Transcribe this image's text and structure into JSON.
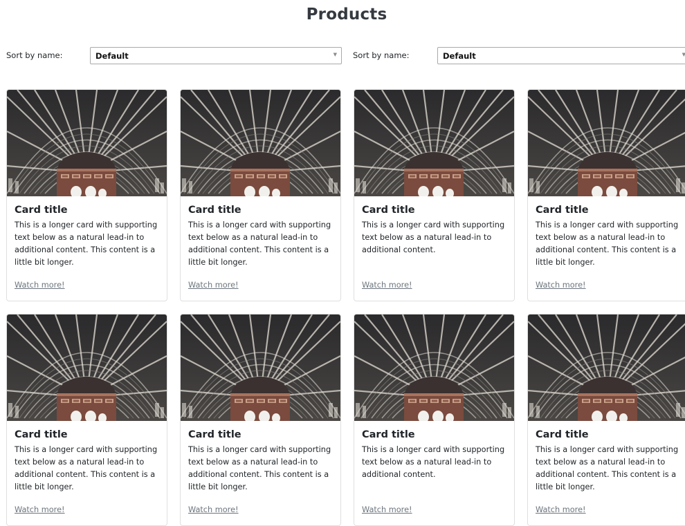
{
  "page": {
    "title": "Products"
  },
  "sort_controls": [
    {
      "label": "Sort by name:",
      "selected": "Default"
    },
    {
      "label": "Sort by name:",
      "selected": "Default"
    }
  ],
  "cards": [
    {
      "title": "Card title",
      "text": "This is a longer card with supporting text below as a natural lead-in to additional content. This content is a little bit longer.",
      "link": "Watch more!"
    },
    {
      "title": "Card title",
      "text": "This is a longer card with supporting text below as a natural lead-in to additional content. This content is a little bit longer.",
      "link": "Watch more!"
    },
    {
      "title": "Card title",
      "text": "This is a longer card with supporting text below as a natural lead-in to additional content.",
      "link": "Watch more!"
    },
    {
      "title": "Card title",
      "text": "This is a longer card with supporting text below as a natural lead-in to additional content. This content is a little bit longer.",
      "link": "Watch more!"
    },
    {
      "title": "Card title",
      "text": "This is a longer card with supporting text below as a natural lead-in to additional content. This content is a little bit longer.",
      "link": "Watch more!"
    },
    {
      "title": "Card title",
      "text": "This is a longer card with supporting text below as a natural lead-in to additional content. This content is a little bit longer.",
      "link": "Watch more!"
    },
    {
      "title": "Card title",
      "text": "This is a longer card with supporting text below as a natural lead-in to additional content.",
      "link": "Watch more!"
    },
    {
      "title": "Card title",
      "text": "This is a longer card with supporting text below as a natural lead-in to additional content. This content is a little bit longer.",
      "link": "Watch more!"
    }
  ],
  "colors": {
    "link": "#6c757d",
    "border": "#dfdfdf",
    "title": "#343a40"
  }
}
